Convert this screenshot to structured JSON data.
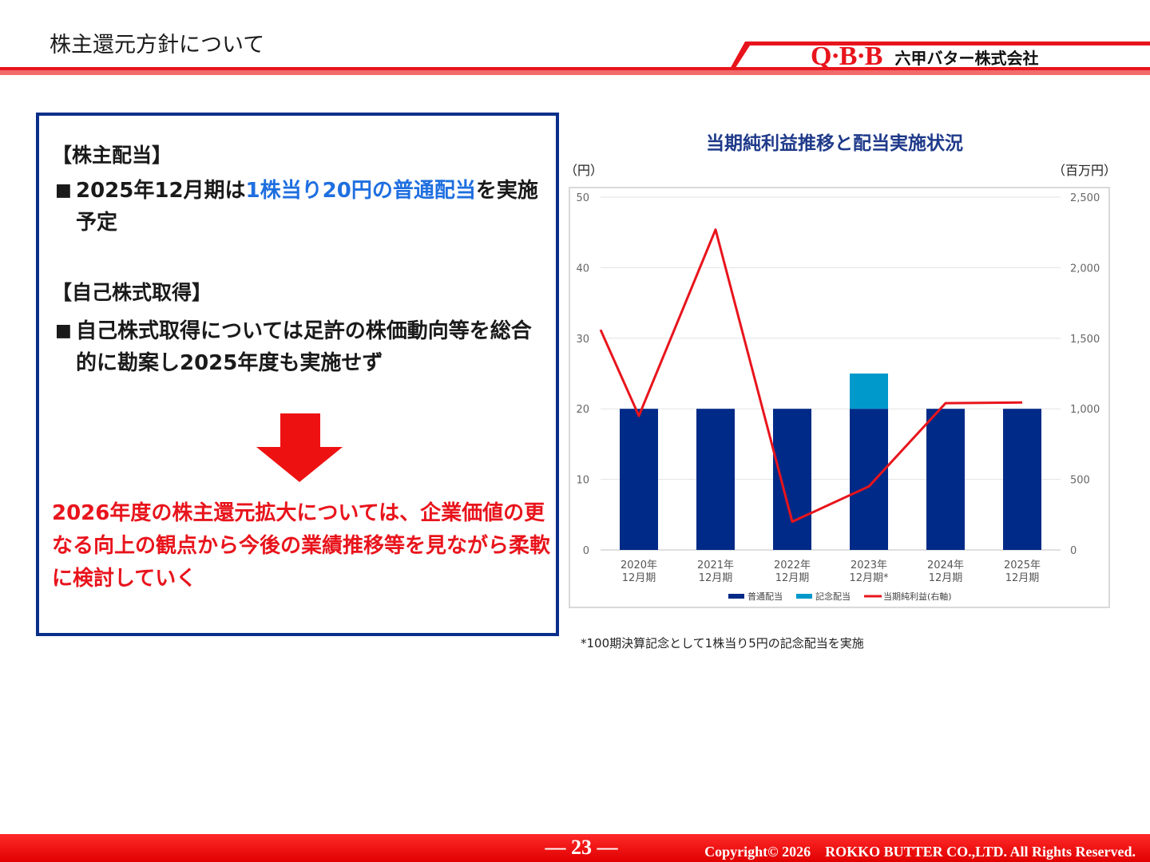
{
  "header": {
    "title": "株主還元方針について",
    "brand_logo": "Q·B·B",
    "brand_name": "六甲バター株式会社"
  },
  "policy": {
    "dividend_heading": "【株主配当】",
    "dividend_text_before": "2025年12月期は",
    "dividend_text_highlight": "1株当り20円の普通配当",
    "dividend_text_after": "を実施予定",
    "buyback_heading": "【自己株式取得】",
    "buyback_text": "自己株式取得については足許の株価動向等を総合的に勘案し2025年度も実施せず",
    "bullet_mark": "■",
    "outlook_text": "2026年度の株主還元拡大については、企業価値の更なる向上の観点から今後の業績推移等を見ながら柔軟に検討していく",
    "arrow_color": "#ee1111"
  },
  "chart_data": {
    "type": "bar",
    "title": "当期純利益推移と配当実施状況",
    "ylabel": "（円）",
    "ylabel_right": "（百万円）",
    "categories": [
      [
        "2020年",
        "12月期"
      ],
      [
        "2021年",
        "12月期"
      ],
      [
        "2022年",
        "12月期"
      ],
      [
        "2023年",
        "12月期*"
      ],
      [
        "2024年",
        "12月期"
      ],
      [
        "2025年",
        "12月期"
      ]
    ],
    "ylim": [
      0,
      50
    ],
    "ylim_right": [
      0,
      2500
    ],
    "yticks": [
      "0",
      "10",
      "20",
      "30",
      "40",
      "50"
    ],
    "yticks_right": [
      "0",
      "500",
      "1,000",
      "1,500",
      "2,000",
      "2,500"
    ],
    "grid": true,
    "legend_position": "bottom",
    "series": [
      {
        "name": "普通配当",
        "type": "bar",
        "stack": "dividend",
        "axis": "left",
        "color": "#002a87",
        "values": [
          20,
          20,
          20,
          20,
          20,
          20
        ]
      },
      {
        "name": "記念配当",
        "type": "bar",
        "stack": "dividend",
        "axis": "left",
        "color": "#0099cc",
        "values": [
          0,
          0,
          0,
          5,
          0,
          0
        ]
      },
      {
        "name": "当期純利益(右軸)",
        "type": "line",
        "axis": "right",
        "color": "#e8141c",
        "values": [
          950,
          2270,
          200,
          450,
          1040,
          1045
        ],
        "start_value": 1560
      }
    ],
    "footnote": "*100期決算記念として1株当り5円の記念配当を実施"
  },
  "footer": {
    "page_number": "― 23 ―",
    "copyright": "Copyright© 2026　ROKKO BUTTER CO.,LTD. All Rights Reserved."
  },
  "colors": {
    "accent_red": "#e8141c",
    "panel_border": "#0a2f8a",
    "highlight_blue": "#1f6fe0"
  }
}
